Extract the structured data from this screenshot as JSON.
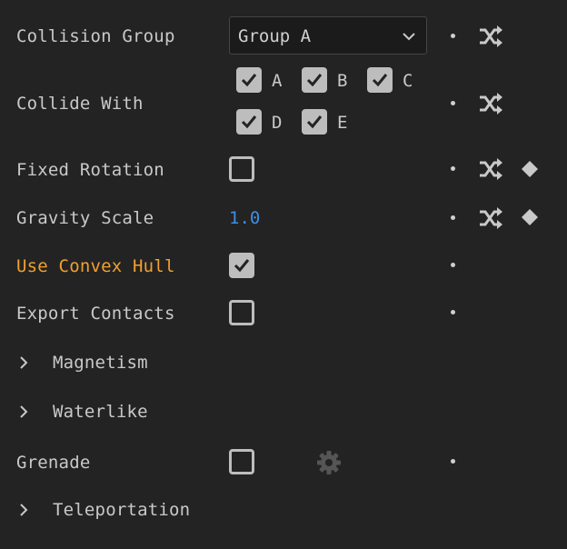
{
  "properties": {
    "collision_group": {
      "label": "Collision Group",
      "value": "Group A"
    },
    "collide_with": {
      "label": "Collide With",
      "options": [
        {
          "label": "A",
          "checked": true
        },
        {
          "label": "B",
          "checked": true
        },
        {
          "label": "C",
          "checked": true
        },
        {
          "label": "D",
          "checked": true
        },
        {
          "label": "E",
          "checked": true
        }
      ]
    },
    "fixed_rotation": {
      "label": "Fixed Rotation",
      "checked": false
    },
    "gravity_scale": {
      "label": "Gravity Scale",
      "value": "1.0"
    },
    "use_convex_hull": {
      "label": "Use Convex Hull",
      "checked": true
    },
    "export_contacts": {
      "label": "Export Contacts",
      "checked": false
    },
    "magnetism": {
      "label": "Magnetism",
      "expanded": false
    },
    "waterlike": {
      "label": "Waterlike",
      "expanded": false
    },
    "grenade": {
      "label": "Grenade",
      "checked": false
    },
    "teleportation": {
      "label": "Teleportation",
      "expanded": false
    }
  },
  "icons": {
    "randomize": "shuffle-icon",
    "keyframe": "diamond-icon",
    "settings": "gear-icon",
    "expand": "chevron-right-icon",
    "dropdown": "chevron-down-icon",
    "modified": "dot-icon"
  },
  "colors": {
    "background": "#232323",
    "text": "#c9c9c9",
    "accent_label": "#f0a030",
    "value": "#3f8fe0",
    "checkbox": "#bdbdbd"
  }
}
